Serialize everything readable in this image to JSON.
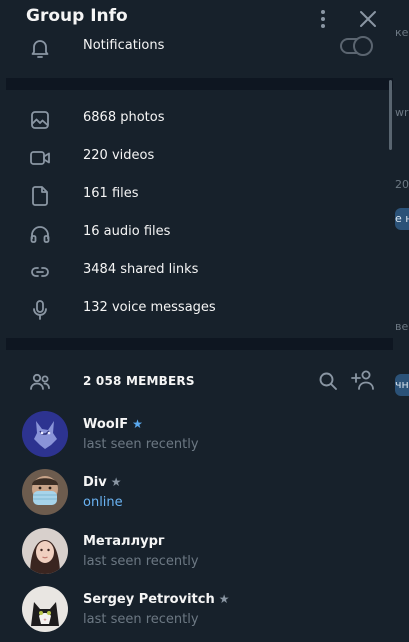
{
  "app": {
    "title": "Group Info"
  },
  "notifications": {
    "label": "Notifications",
    "enabled": false
  },
  "media": [
    {
      "icon": "photo-icon",
      "label": "6868 photos"
    },
    {
      "icon": "video-icon",
      "label": "220 videos"
    },
    {
      "icon": "file-icon",
      "label": "161 files"
    },
    {
      "icon": "headphones-icon",
      "label": "16 audio files"
    },
    {
      "icon": "link-icon",
      "label": "3484 shared links"
    },
    {
      "icon": "microphone-icon",
      "label": "132 voice messages"
    }
  ],
  "members": {
    "title": "2 058 MEMBERS",
    "list": [
      {
        "name": "WoolF",
        "star_color": "#5aa9ef",
        "status": "last seen recently",
        "online": false
      },
      {
        "name": "Div",
        "star_color": "#8a96a3",
        "status": "online",
        "online": true
      },
      {
        "name": "Металлург",
        "star_color": "",
        "status": "last seen recently",
        "online": false
      },
      {
        "name": "Sergey Petrovitch",
        "star_color": "#8a96a3",
        "status": "last seen recently",
        "online": false
      }
    ]
  },
  "colors": {
    "panel_bg": "#17212b",
    "window_bg": "#0e1621",
    "accent": "#6ab3f3",
    "muted_text": "#6c7883"
  },
  "background": {
    "fragments": [
      "ке",
      "wr",
      "20",
      "е н",
      "ве",
      "чн"
    ]
  }
}
